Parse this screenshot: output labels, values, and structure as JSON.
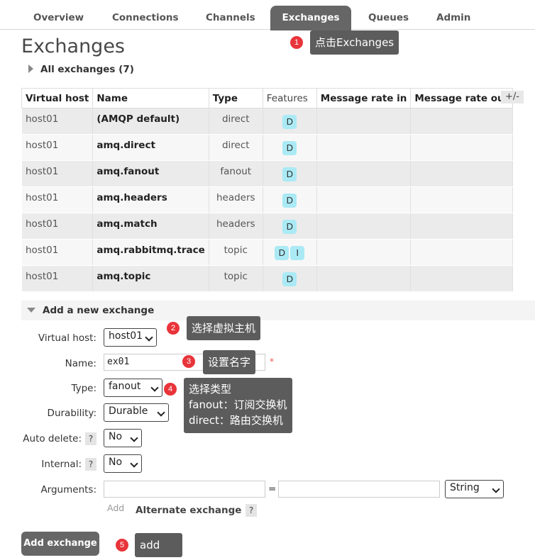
{
  "nav": {
    "tabs": [
      "Overview",
      "Connections",
      "Channels",
      "Exchanges",
      "Queues",
      "Admin"
    ],
    "active": "Exchanges"
  },
  "page": {
    "title": "Exchanges",
    "all_exchanges_label": "All exchanges (7)"
  },
  "table": {
    "headers": [
      "Virtual host",
      "Name",
      "Type",
      "Features",
      "Message rate in",
      "Message rate out"
    ],
    "toggle_columns_label": "+/-",
    "rows": [
      {
        "vhost": "host01",
        "name": "(AMQP default)",
        "type": "direct",
        "features": [
          "D"
        ]
      },
      {
        "vhost": "host01",
        "name": "amq.direct",
        "type": "direct",
        "features": [
          "D"
        ]
      },
      {
        "vhost": "host01",
        "name": "amq.fanout",
        "type": "fanout",
        "features": [
          "D"
        ]
      },
      {
        "vhost": "host01",
        "name": "amq.headers",
        "type": "headers",
        "features": [
          "D"
        ]
      },
      {
        "vhost": "host01",
        "name": "amq.match",
        "type": "headers",
        "features": [
          "D"
        ]
      },
      {
        "vhost": "host01",
        "name": "amq.rabbitmq.trace",
        "type": "topic",
        "features": [
          "D",
          "I"
        ]
      },
      {
        "vhost": "host01",
        "name": "amq.topic",
        "type": "topic",
        "features": [
          "D"
        ]
      }
    ]
  },
  "form": {
    "section_label": "Add a new exchange",
    "virtual_host_label": "Virtual host:",
    "virtual_host_value": "host01",
    "name_label": "Name:",
    "name_value": "ex01",
    "required_mark": "*",
    "type_label": "Type:",
    "type_value": "fanout",
    "durability_label": "Durability:",
    "durability_value": "Durable",
    "auto_delete_label": "Auto delete:",
    "auto_delete_value": "No",
    "internal_label": "Internal:",
    "internal_value": "No",
    "arguments_label": "Arguments:",
    "arguments_key": "",
    "arguments_value": "",
    "arguments_equals": "=",
    "arguments_type": "String",
    "add_link": "Add",
    "alternate_exchange_label": "Alternate exchange",
    "help_mark": "?",
    "submit_label": "Add exchange"
  },
  "annotations": [
    {
      "num": "1",
      "text": "点击Exchanges"
    },
    {
      "num": "2",
      "text": "选择虚拟主机"
    },
    {
      "num": "3",
      "text": "设置名字"
    },
    {
      "num": "4",
      "text": "选择类型\nfanout：订阅交换机\ndirect：路由交换机"
    },
    {
      "num": "5",
      "text": "add"
    }
  ],
  "colors": {
    "active_tab": "#666666",
    "badge": "#aaeaf5",
    "annotation_circle": "#e8343a",
    "annotation_box": "#5c5c5c"
  }
}
